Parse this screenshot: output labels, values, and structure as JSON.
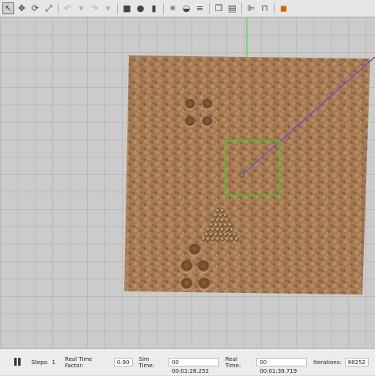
{
  "toolbar": {
    "tools": [
      {
        "name": "select-icon",
        "glyph": "↖",
        "active": true
      },
      {
        "name": "translate-icon",
        "glyph": "✥"
      },
      {
        "name": "rotate-icon",
        "glyph": "⟳"
      },
      {
        "name": "scale-icon",
        "glyph": "⤢"
      },
      {
        "sep": true
      },
      {
        "name": "undo-icon",
        "glyph": "↶",
        "disabled": true
      },
      {
        "name": "undo-dropdown-icon",
        "glyph": "▾",
        "disabled": true
      },
      {
        "name": "redo-icon",
        "glyph": "↷",
        "disabled": true
      },
      {
        "name": "redo-dropdown-icon",
        "glyph": "▾",
        "disabled": true
      },
      {
        "sep": true
      },
      {
        "name": "box-icon",
        "glyph": "■"
      },
      {
        "name": "sphere-icon",
        "glyph": "●"
      },
      {
        "name": "cylinder-icon",
        "glyph": "▮"
      },
      {
        "sep": true
      },
      {
        "name": "point-light-icon",
        "glyph": "✳"
      },
      {
        "name": "spot-light-icon",
        "glyph": "◒"
      },
      {
        "name": "directional-light-icon",
        "glyph": "≡"
      },
      {
        "sep": true
      },
      {
        "name": "copy-icon",
        "glyph": "❐"
      },
      {
        "name": "paste-icon",
        "glyph": "▤"
      },
      {
        "sep": true
      },
      {
        "name": "align-icon",
        "glyph": "⊫"
      },
      {
        "name": "snap-icon",
        "glyph": "⊓"
      },
      {
        "sep": true
      },
      {
        "name": "screenshot-icon",
        "glyph": "◼",
        "orange": true
      }
    ]
  },
  "status": {
    "steps_label": "Steps:",
    "steps_value": "1",
    "rtf_label": "Real Time Factor:",
    "rtf_value": "0.90",
    "sim_time_label": "Sim Time:",
    "sim_time_value": "00 00:01:28.252",
    "real_time_label": "Real Time:",
    "real_time_value": "00 00:01:39.719",
    "iterations_label": "Iterations:",
    "iterations_value": "88252"
  },
  "colors": {
    "grid_line": "#a9a9a9",
    "ground": "#a57a52",
    "selection_box": "#2ed12e",
    "laser_ray": "#6a4fd6",
    "axis_green": "#3fe03f"
  }
}
